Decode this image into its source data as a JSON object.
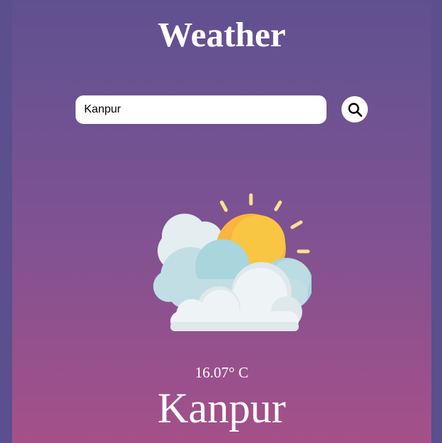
{
  "app": {
    "title": "Weather"
  },
  "search": {
    "value": "Kanpur",
    "placeholder": "",
    "button_icon": "search-icon"
  },
  "weather": {
    "icon": "partly-cloudy-sun-icon",
    "temperature": "16.07° C",
    "city": "Kanpur"
  },
  "colors": {
    "background": "#5b4f8d",
    "gradient_top": "#5f5190",
    "gradient_bottom": "#a55089",
    "sun": "#f9b53f",
    "cloud": "#eef4f6"
  }
}
